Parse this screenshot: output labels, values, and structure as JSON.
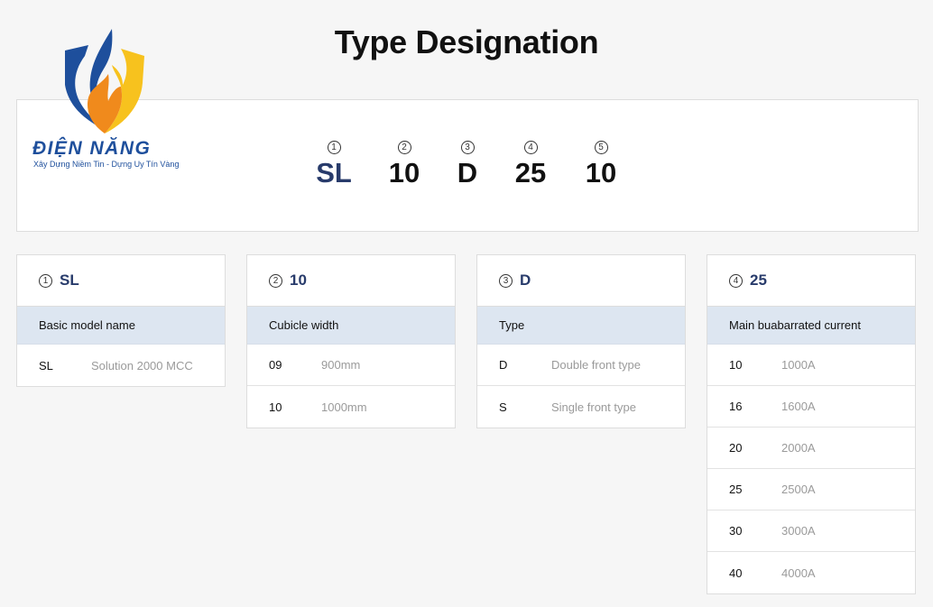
{
  "page_title": "Type Designation",
  "logo": {
    "brand": "ĐIỆN NĂNG",
    "slogan": "Xây Dựng Niềm Tin - Dựng Uy Tín Vàng",
    "colors": {
      "blue": "#1e4f9c",
      "orange": "#f08a1c",
      "yellow": "#f7c21e"
    }
  },
  "designation": {
    "parts": [
      {
        "num": "1",
        "value": "SL"
      },
      {
        "num": "2",
        "value": "10"
      },
      {
        "num": "3",
        "value": "D"
      },
      {
        "num": "4",
        "value": "25"
      },
      {
        "num": "5",
        "value": "10"
      }
    ]
  },
  "cards": [
    {
      "num": "1",
      "code": "SL",
      "heading": "Basic model name",
      "rows": [
        {
          "code": "SL",
          "desc": "Solution 2000 MCC"
        }
      ]
    },
    {
      "num": "2",
      "code": "10",
      "heading": "Cubicle width",
      "rows": [
        {
          "code": "09",
          "desc": "900mm"
        },
        {
          "code": "10",
          "desc": "1000mm"
        }
      ]
    },
    {
      "num": "3",
      "code": "D",
      "heading": "Type",
      "rows": [
        {
          "code": "D",
          "desc": "Double front type"
        },
        {
          "code": "S",
          "desc": "Single front type"
        }
      ]
    },
    {
      "num": "4",
      "code": "25",
      "heading": "Main buabarrated current",
      "rows": [
        {
          "code": "10",
          "desc": "1000A"
        },
        {
          "code": "16",
          "desc": "1600A"
        },
        {
          "code": "20",
          "desc": "2000A"
        },
        {
          "code": "25",
          "desc": "2500A"
        },
        {
          "code": "30",
          "desc": "3000A"
        },
        {
          "code": "40",
          "desc": "4000A"
        }
      ]
    }
  ],
  "colors": {
    "accent": "#283b6b",
    "subhead_bg": "#dde6f1",
    "muted": "#9a9a9a"
  }
}
